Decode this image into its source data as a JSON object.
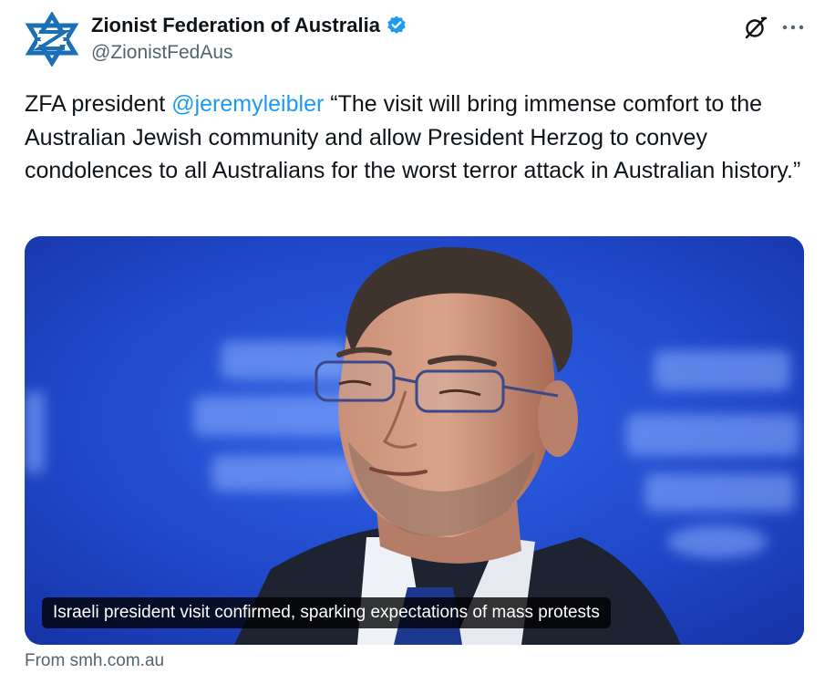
{
  "author": {
    "display_name": "Zionist Federation of Australia",
    "handle": "@ZionistFedAus",
    "verified": true,
    "avatar_icon": "zfa-star-logo"
  },
  "actions": {
    "grok_icon": "grok-icon",
    "more_icon": "more-dots-icon"
  },
  "tweet": {
    "text_before": "ZFA president ",
    "mention": "@jeremyleibler",
    "text_after": " “The visit will bring immense comfort to the Australian Jewish community and allow President Herzog to convey condolences to all Australians for the worst terror attack in Australian history.”"
  },
  "card": {
    "caption": "Israeli president visit confirmed, sparking expectations of mass protests",
    "source": "From smh.com.au",
    "image_subject": "photo of man with glasses in suit against blue background"
  },
  "colors": {
    "link": "#1d9bf0",
    "verified": "#1d9bf0",
    "secondary_text": "#536471",
    "card_background": "#1f47c9"
  }
}
